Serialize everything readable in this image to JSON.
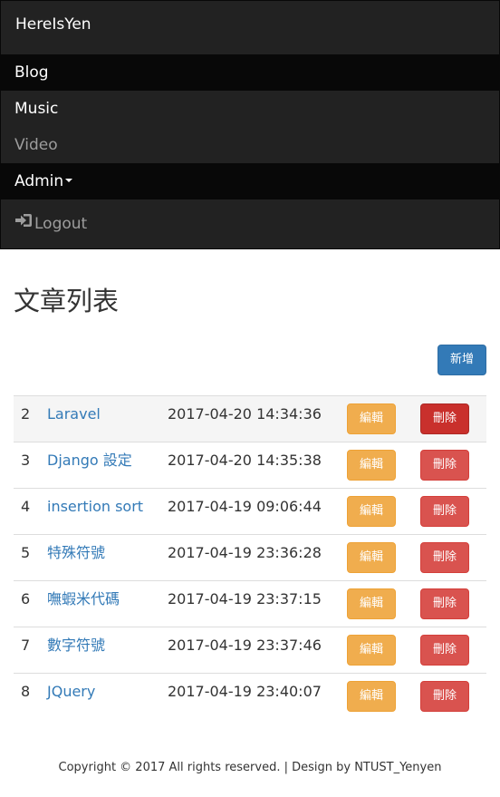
{
  "navbar": {
    "brand": "HereIsYen",
    "items": [
      {
        "label": "Blog"
      },
      {
        "label": "Music"
      },
      {
        "label": "Video"
      },
      {
        "label": "Admin"
      },
      {
        "label": "Logout"
      }
    ]
  },
  "page": {
    "title": "文章列表",
    "add_label": "新增"
  },
  "table": {
    "rows": [
      {
        "id": "2",
        "title": "Laravel",
        "time": "2017-04-20 14:34:36",
        "edit": "編輯",
        "delete": "刪除"
      },
      {
        "id": "3",
        "title": "Django 設定",
        "time": "2017-04-20 14:35:38",
        "edit": "編輯",
        "delete": "刪除"
      },
      {
        "id": "4",
        "title": "insertion sort",
        "time": "2017-04-19 09:06:44",
        "edit": "編輯",
        "delete": "刪除"
      },
      {
        "id": "5",
        "title": "特殊符號",
        "time": "2017-04-19 23:36:28",
        "edit": "編輯",
        "delete": "刪除"
      },
      {
        "id": "6",
        "title": "嘸蝦米代碼",
        "time": "2017-04-19 23:37:15",
        "edit": "編輯",
        "delete": "刪除"
      },
      {
        "id": "7",
        "title": "數字符號",
        "time": "2017-04-19 23:37:46",
        "edit": "編輯",
        "delete": "刪除"
      },
      {
        "id": "8",
        "title": "JQuery",
        "time": "2017-04-19 23:40:07",
        "edit": "編輯",
        "delete": "刪除"
      }
    ]
  },
  "footer": {
    "text": "Copyright © 2017 All rights reserved. | Design by NTUST_Yenyen"
  },
  "colors": {
    "navbar_bg": "#222222",
    "primary": "#337ab7",
    "warning": "#f0ad4e",
    "danger": "#d9534f",
    "link": "#337ab7"
  },
  "icons": {
    "logout": "log-in-icon"
  }
}
